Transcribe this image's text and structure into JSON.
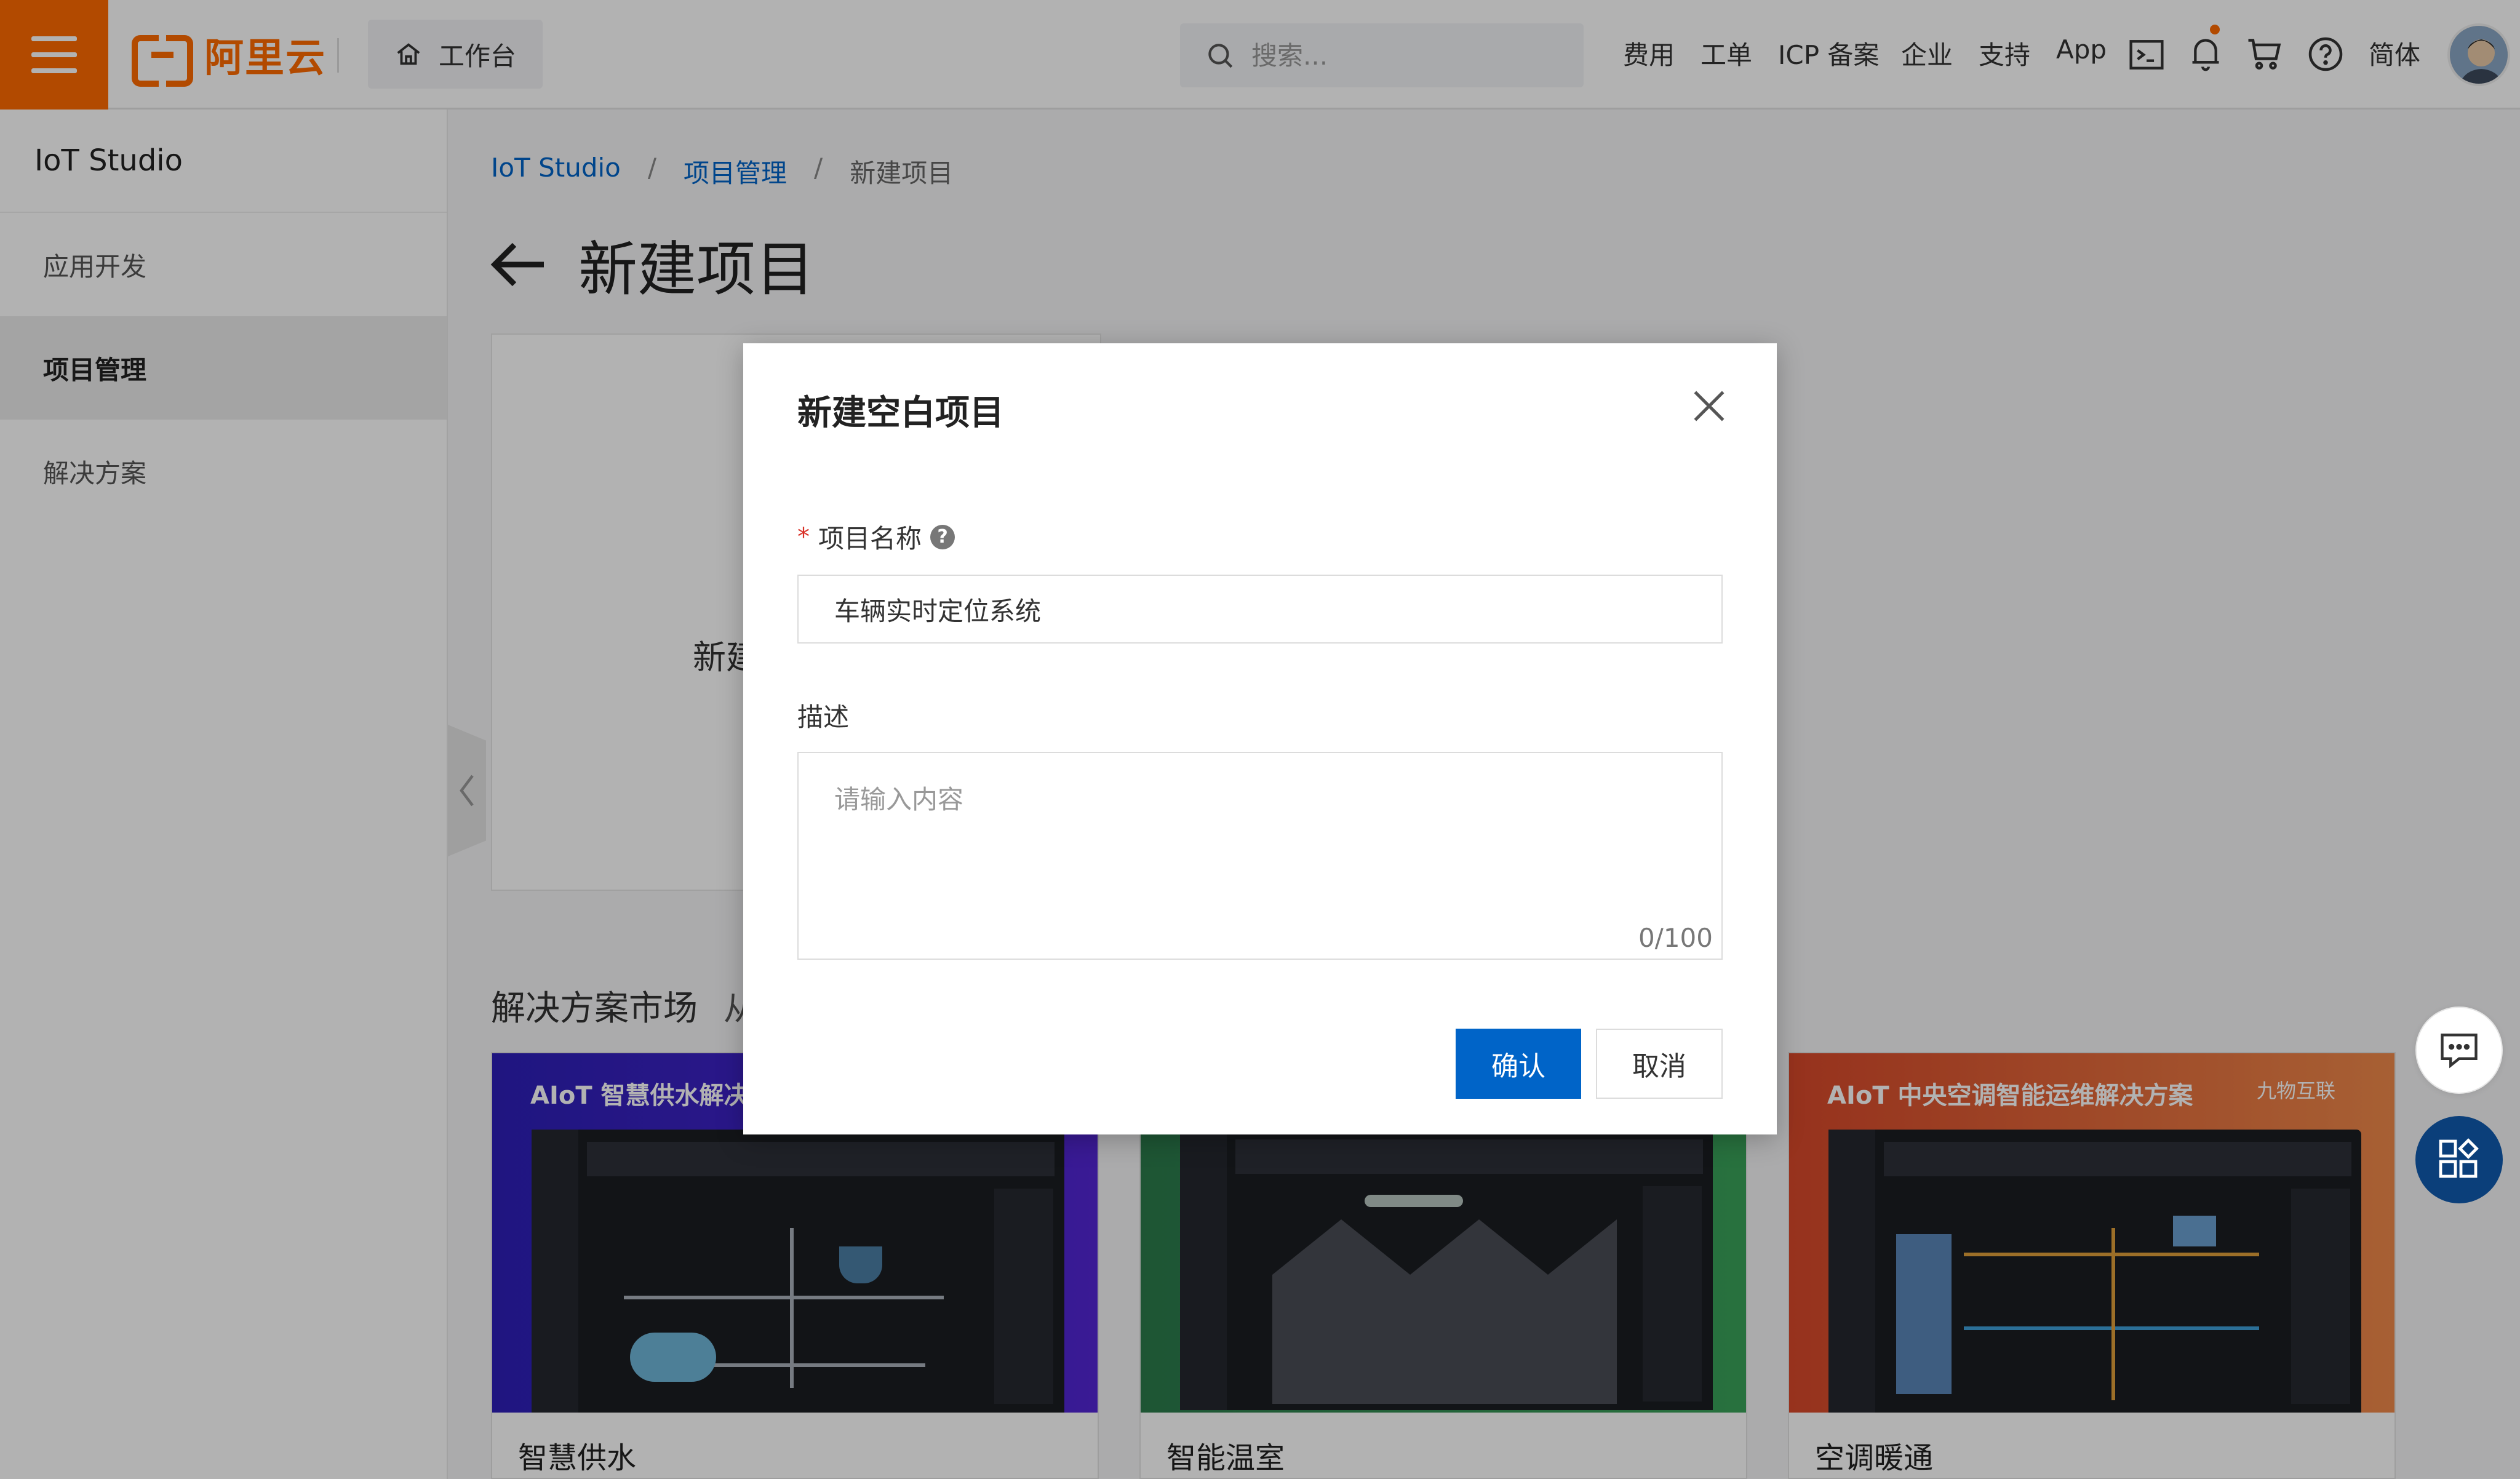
{
  "topbar": {
    "logo_text": "阿里云",
    "workbench_label": "工作台",
    "search_placeholder": "搜索...",
    "nav": [
      "费用",
      "工单",
      "ICP 备案",
      "企业",
      "支持",
      "App"
    ],
    "language": "简体"
  },
  "sidebar": {
    "title": "IoT Studio",
    "items": [
      {
        "label": "应用开发",
        "active": false
      },
      {
        "label": "项目管理",
        "active": true
      },
      {
        "label": "解决方案",
        "active": false
      }
    ]
  },
  "breadcrumb": {
    "items": [
      "IoT Studio",
      "项目管理",
      "新建项目"
    ],
    "separator": "/"
  },
  "page": {
    "title": "新建项目",
    "blank_card_text": "新建",
    "market_title": "解决方案市场",
    "market_sub": "从"
  },
  "solutions": [
    {
      "name": "智慧供水",
      "banner_title": "AIoT 智慧供水解决方",
      "color": "#3b22c9"
    },
    {
      "name": "智能温室",
      "banner_title": "",
      "color": "#2f8a4e"
    },
    {
      "name": "空调暖通",
      "banner_title": "AIoT 中央空调智能运维解决方案",
      "color": "#e05a2b",
      "brand": "九物互联"
    }
  ],
  "modal": {
    "title": "新建空白项目",
    "name_label": "项目名称",
    "required_mark": "*",
    "name_value": "车辆实时定位系统",
    "desc_label": "描述",
    "desc_placeholder": "请输入内容",
    "counter": "0/100",
    "confirm_label": "确认",
    "cancel_label": "取消"
  },
  "colors": {
    "brand_orange": "#ff6a00",
    "primary_blue": "#0064c8"
  }
}
